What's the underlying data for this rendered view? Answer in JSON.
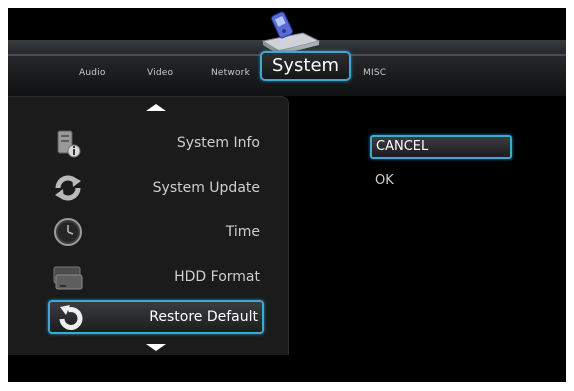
{
  "header": {
    "tabs": [
      "Audio",
      "Video",
      "Network"
    ],
    "active_tab": "System",
    "misc_tab": "MISC"
  },
  "menu": {
    "items": [
      {
        "label": "System Info",
        "icon": "system-info-icon"
      },
      {
        "label": "System Update",
        "icon": "refresh-icon"
      },
      {
        "label": "Time",
        "icon": "clock-icon"
      },
      {
        "label": "HDD Format",
        "icon": "hdd-icon"
      },
      {
        "label": "Restore Default",
        "icon": "restore-icon"
      }
    ],
    "selected": "Restore Default"
  },
  "options": {
    "cancel": "CANCEL",
    "ok": "OK"
  },
  "colors": {
    "highlight_border": "#3fa7d0",
    "background": "#000000"
  }
}
